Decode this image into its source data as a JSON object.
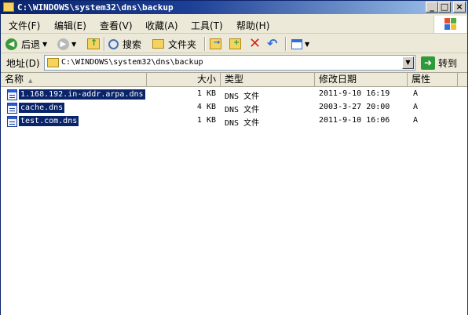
{
  "window": {
    "title": "C:\\WINDOWS\\system32\\dns\\backup"
  },
  "title_buttons": {
    "minimize": "_",
    "maximize": "□",
    "close": "×"
  },
  "menu": [
    "文件(F)",
    "编辑(E)",
    "查看(V)",
    "收藏(A)",
    "工具(T)",
    "帮助(H)"
  ],
  "toolbar": {
    "back_label": "后退",
    "search_label": "搜索",
    "folders_label": "文件夹"
  },
  "address": {
    "label": "地址(D)",
    "path": "C:\\WINDOWS\\system32\\dns\\backup",
    "go_label": "转到"
  },
  "columns": {
    "name": "名称",
    "size": "大小",
    "type": "类型",
    "modified": "修改日期",
    "attributes": "属性"
  },
  "files": [
    {
      "name": "1.168.192.in-addr.arpa.dns",
      "size": "1 KB",
      "type": "DNS 文件",
      "modified": "2011-9-10 16:19",
      "attr": "A"
    },
    {
      "name": "cache.dns",
      "size": "4 KB",
      "type": "DNS 文件",
      "modified": "2003-3-27 20:00",
      "attr": "A"
    },
    {
      "name": "test.com.dns",
      "size": "1 KB",
      "type": "DNS 文件",
      "modified": "2011-9-10 16:06",
      "attr": "A"
    }
  ],
  "colors": {
    "title_start": "#0a246a",
    "title_end": "#a6caf0",
    "selection": "#0a246a",
    "chrome": "#ece9d8"
  },
  "icons": [
    "back-arrow-icon",
    "forward-arrow-icon",
    "up-folder-icon",
    "search-icon",
    "folders-icon",
    "move-to-icon",
    "copy-to-icon",
    "delete-icon",
    "undo-icon",
    "views-icon",
    "go-arrow-icon"
  ]
}
